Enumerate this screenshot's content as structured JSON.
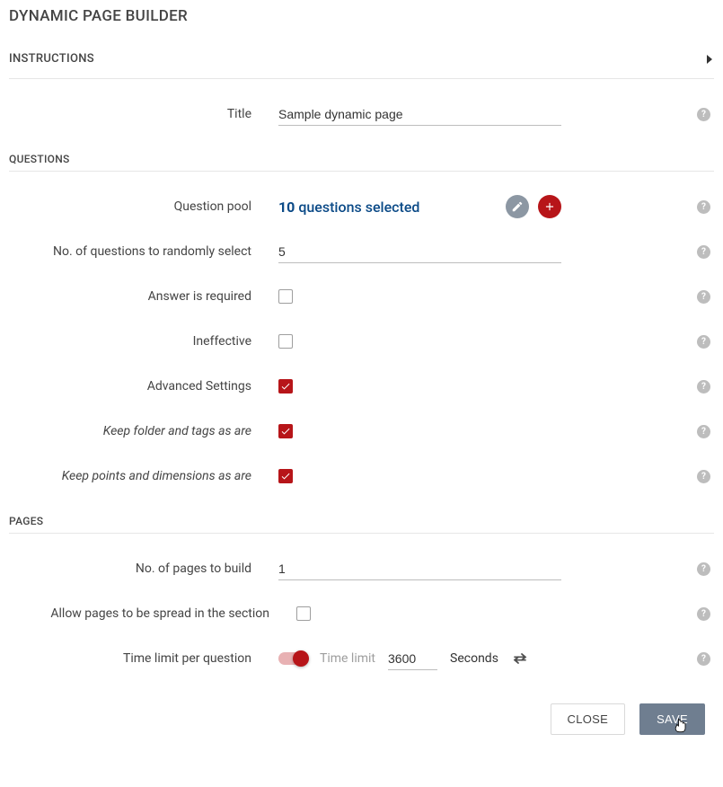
{
  "header": {
    "title": "DYNAMIC PAGE BUILDER"
  },
  "instructions": {
    "label": "INSTRUCTIONS"
  },
  "title_row": {
    "label": "Title",
    "value": "Sample dynamic page"
  },
  "questions": {
    "group_label": "QUESTIONS",
    "pool": {
      "label": "Question pool",
      "count": "10",
      "suffix": "questions selected"
    },
    "random": {
      "label": "No. of questions to randomly select",
      "value": "5"
    },
    "answer_required": {
      "label": "Answer is required"
    },
    "ineffective": {
      "label": "Ineffective"
    },
    "advanced": {
      "label": "Advanced Settings"
    },
    "keep_folder": {
      "label": "Keep folder and tags as are"
    },
    "keep_points": {
      "label": "Keep points and dimensions as are"
    }
  },
  "pages": {
    "group_label": "PAGES",
    "build": {
      "label": "No. of pages to build",
      "value": "1"
    },
    "spread": {
      "label": "Allow pages to be spread in the section"
    },
    "timelimit": {
      "label": "Time limit per question",
      "inner_label": "Time limit",
      "value": "3600",
      "unit": "Seconds"
    }
  },
  "footer": {
    "close": "CLOSE",
    "save": "SAVE"
  }
}
